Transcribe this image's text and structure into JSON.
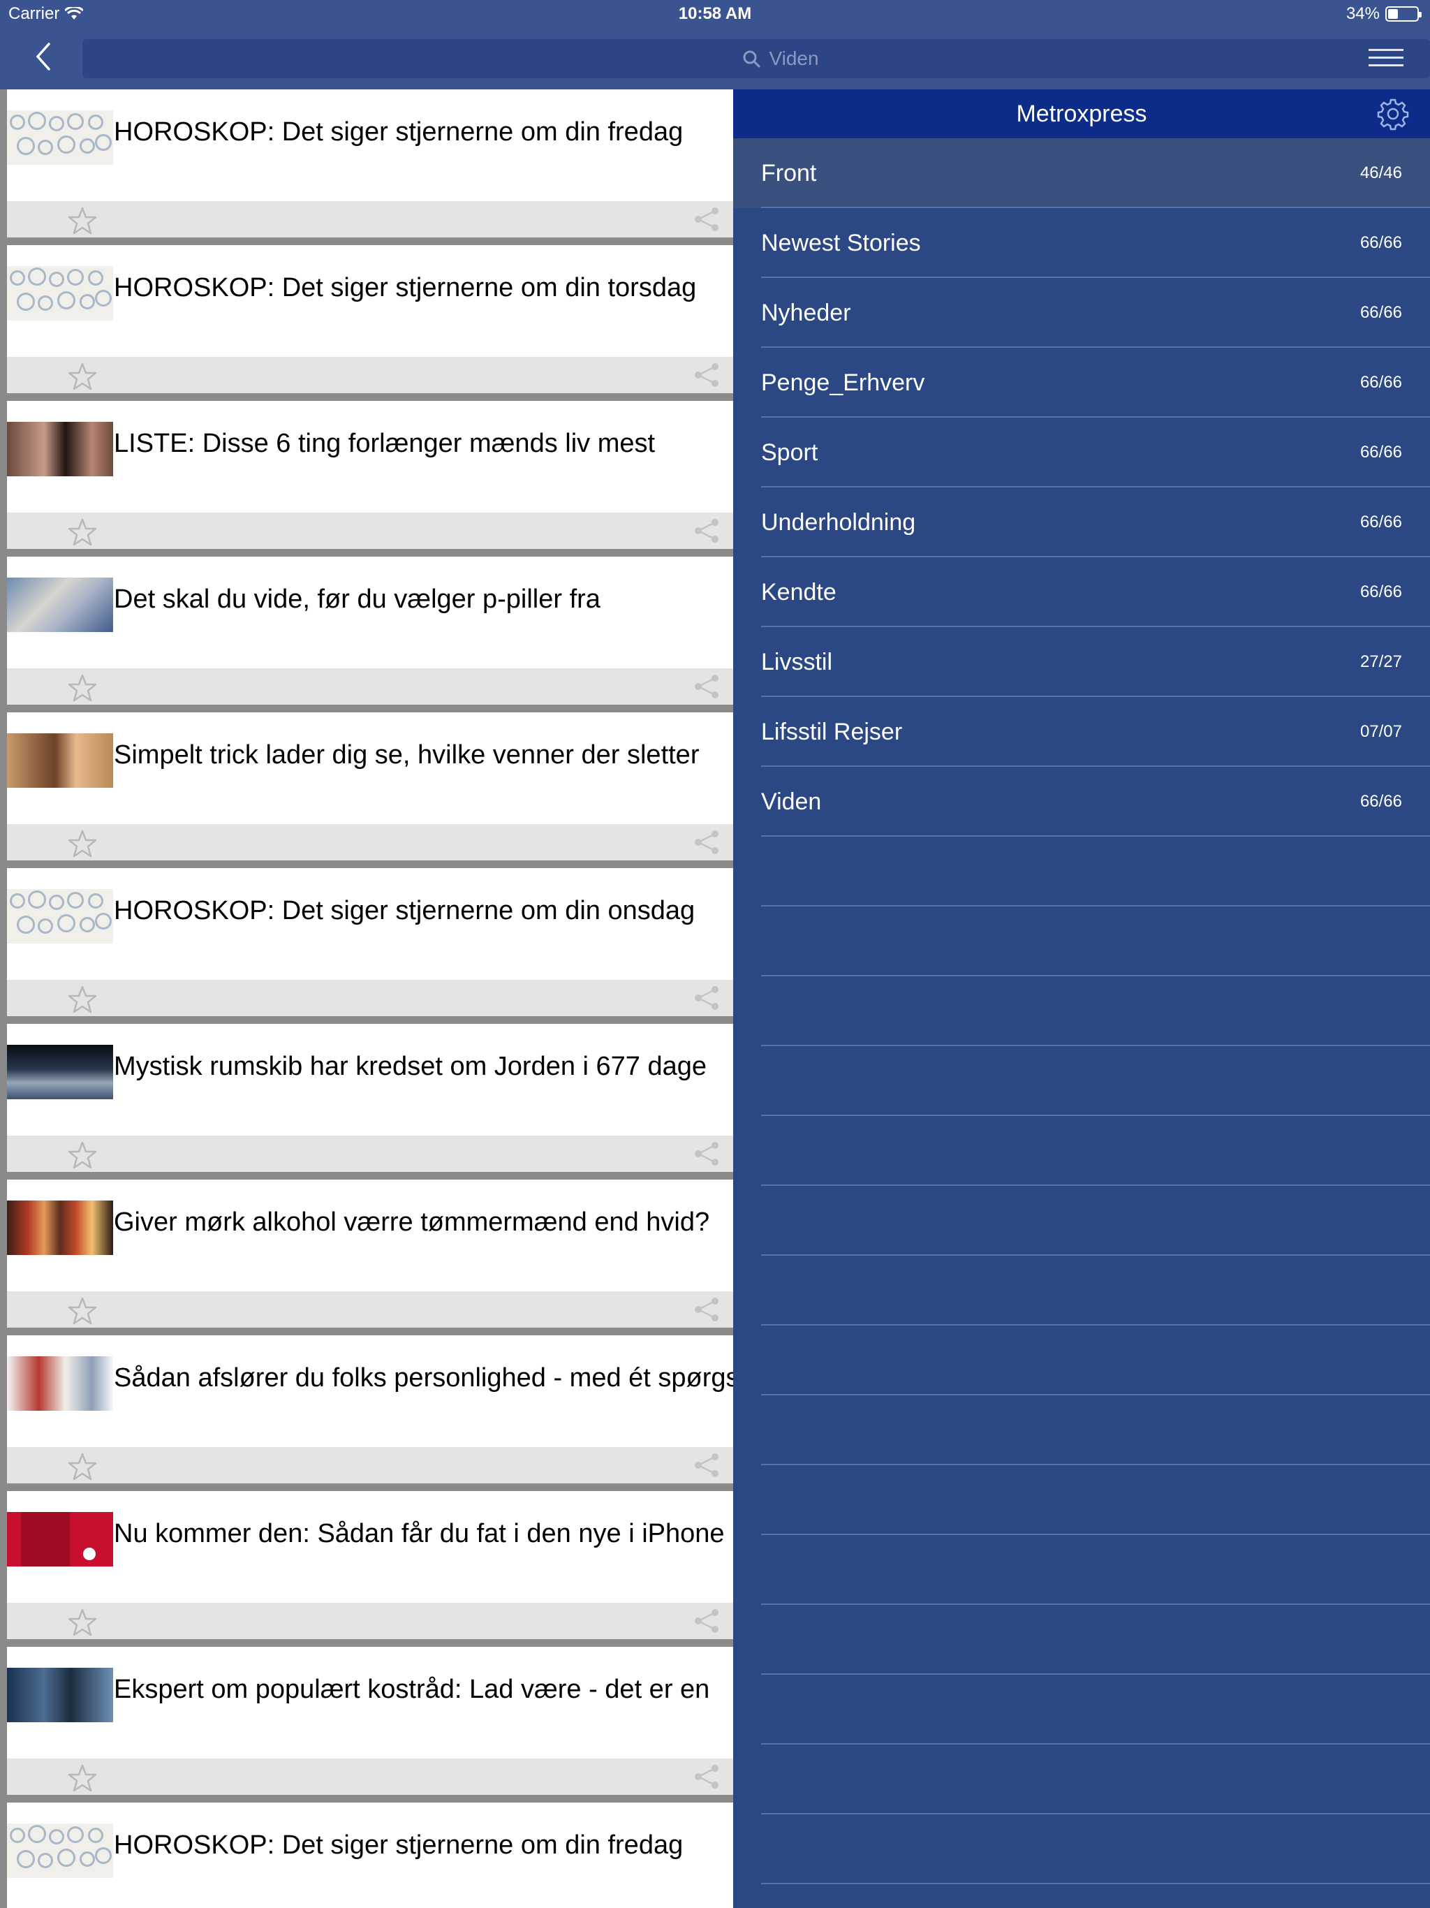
{
  "status_bar": {
    "carrier": "Carrier",
    "time": "10:58 AM",
    "battery": "34%",
    "battery_level": 0.34
  },
  "nav": {
    "search_placeholder": "Viden"
  },
  "articles": [
    {
      "title": "HOROSKOP: Det siger stjernerne om din fredag",
      "thumb": "horoscope"
    },
    {
      "title": "HOROSKOP: Det siger stjernerne om din torsdag",
      "thumb": "horoscope"
    },
    {
      "title": "LISTE: Disse 6 ting forlænger mænds liv mest",
      "thumb": "body"
    },
    {
      "title": "Det skal du vide, før du vælger p-piller fra",
      "thumb": "pills"
    },
    {
      "title": "Simpelt trick lader dig se, hvilke venner der sletter",
      "thumb": "woman"
    },
    {
      "title": "HOROSKOP: Det siger stjernerne om din onsdag",
      "thumb": "horoscope"
    },
    {
      "title": "Mystisk rumskib har kredset om Jorden i 677 dage",
      "thumb": "earth"
    },
    {
      "title": "Giver mørk alkohol værre tømmermænd end hvid?",
      "thumb": "bottles"
    },
    {
      "title": "Sådan afslører du folks personlighed - med ét spørgsmål",
      "thumb": "people"
    },
    {
      "title": "Nu kommer den: Sådan får du fat i den nye i iPhone",
      "thumb": "iphone"
    },
    {
      "title": "Ekspert om populært kostråd: Lad være - det er en",
      "thumb": "fridge"
    },
    {
      "title": "HOROSKOP: Det siger stjernerne om din fredag",
      "thumb": "horoscope"
    }
  ],
  "panel": {
    "title": "Metroxpress",
    "categories": [
      {
        "name": "Front",
        "count": "46/46",
        "active": true
      },
      {
        "name": "Newest Stories",
        "count": "66/66"
      },
      {
        "name": "Nyheder",
        "count": "66/66"
      },
      {
        "name": "Penge_Erhverv",
        "count": "66/66"
      },
      {
        "name": "Sport",
        "count": "66/66"
      },
      {
        "name": "Underholdning",
        "count": "66/66"
      },
      {
        "name": "Kendte",
        "count": "66/66"
      },
      {
        "name": "Livsstil",
        "count": "27/27"
      },
      {
        "name": "Lifsstil Rejser",
        "count": "07/07"
      },
      {
        "name": "Viden",
        "count": "66/66"
      }
    ]
  }
}
